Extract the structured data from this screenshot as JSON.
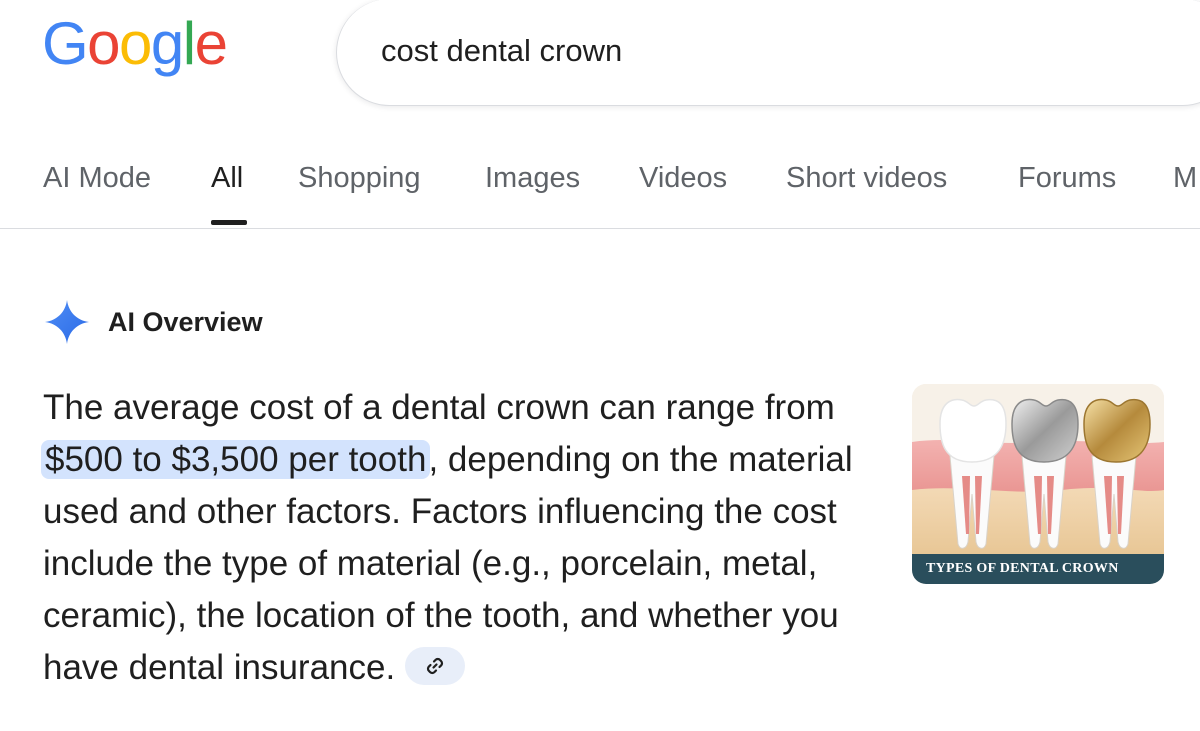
{
  "header": {
    "logo_letters": [
      "G",
      "o",
      "o",
      "g",
      "l",
      "e"
    ],
    "logo_colors": [
      "#4285F4",
      "#EA4335",
      "#FBBC05",
      "#4285F4",
      "#34A853",
      "#EA4335"
    ],
    "search_query": "cost dental crown"
  },
  "tabs": [
    {
      "label": "AI Mode",
      "active": false
    },
    {
      "label": "All",
      "active": true
    },
    {
      "label": "Shopping",
      "active": false
    },
    {
      "label": "Images",
      "active": false
    },
    {
      "label": "Videos",
      "active": false
    },
    {
      "label": "Short videos",
      "active": false
    },
    {
      "label": "Forums",
      "active": false
    },
    {
      "label": "M",
      "active": false
    }
  ],
  "ai_overview": {
    "label": "AI Overview",
    "icon": "sparkle-icon",
    "text_before": "The average cost of a dental crown can range from ",
    "text_highlight": "$500 to $3,500 per tooth",
    "text_after": ", depending on the material used and other factors. Factors in­fluencing the cost include the type of material (e.g., porcelain, metal, ceramic), the location of the tooth, and whether you have dental insurance.",
    "link_icon": "link-icon",
    "image_caption": "TYPES OF DENTAL CROWN",
    "highlight_color": "#d3e3fd"
  }
}
